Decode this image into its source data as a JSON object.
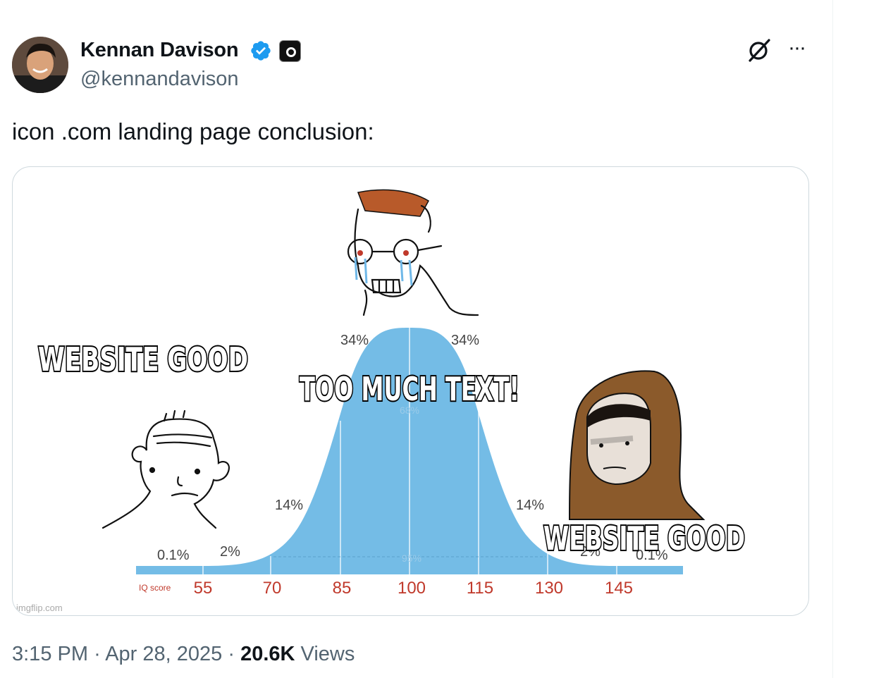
{
  "tweet": {
    "author": {
      "display_name": "Kennan Davison",
      "handle": "@kennandavison",
      "verified": true
    },
    "text": "icon .com landing page conclusion:",
    "timestamp": "3:15 PM",
    "separator": "·",
    "date": "Apr 28, 2025",
    "views_count": "20.6K",
    "views_label": "Views",
    "more_label": "···"
  },
  "meme": {
    "caption_left": "WEBSITE GOOD",
    "caption_center": "TOO MUCH TEXT!",
    "caption_right": "WEBSITE GOOD",
    "percent_top_left": "34%",
    "percent_top_right": "34%",
    "percent_mid_left": "14%",
    "percent_mid_right": "14%",
    "percent_low_left_1": "0.1%",
    "percent_low_left_2": "2%",
    "percent_low_right_1": "2%",
    "percent_low_right_2": "0.1%",
    "center_68": "68%",
    "center_95": "95%",
    "iq_label": "IQ score",
    "iq_ticks": [
      "55",
      "70",
      "85",
      "100",
      "115",
      "130",
      "145"
    ],
    "watermark": "imgflip.com"
  },
  "colors": {
    "accent_blue": "#1d9bf0",
    "bell_curve": "#74bce6",
    "muted_text": "#536471"
  }
}
